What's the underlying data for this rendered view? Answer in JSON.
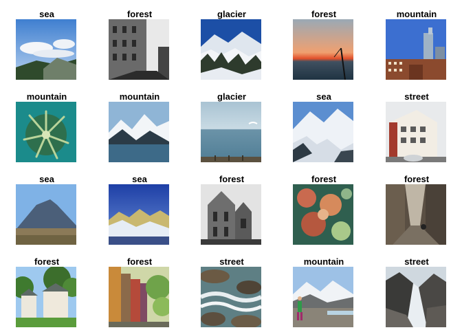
{
  "grid": {
    "rows": [
      [
        {
          "label": "sea",
          "scene": "sea-hills-clouds"
        },
        {
          "label": "forest",
          "scene": "bw-street-buildings"
        },
        {
          "label": "glacier",
          "scene": "snowy-mountain-trees"
        },
        {
          "label": "forest",
          "scene": "sunset-over-sea"
        },
        {
          "label": "mountain",
          "scene": "city-skyline"
        }
      ],
      [
        {
          "label": "mountain",
          "scene": "underwater-anemone"
        },
        {
          "label": "mountain",
          "scene": "snow-mountains-lake"
        },
        {
          "label": "glacier",
          "scene": "calm-sea-gull"
        },
        {
          "label": "sea",
          "scene": "snow-glacier-valley"
        },
        {
          "label": "street",
          "scene": "apartment-building"
        }
      ],
      [
        {
          "label": "sea",
          "scene": "volcano-peak"
        },
        {
          "label": "sea",
          "scene": "blue-mountain-range"
        },
        {
          "label": "forest",
          "scene": "bw-cathedral"
        },
        {
          "label": "forest",
          "scene": "coral-reef"
        },
        {
          "label": "forest",
          "scene": "narrow-alley"
        }
      ],
      [
        {
          "label": "forest",
          "scene": "round-pavilion-trees"
        },
        {
          "label": "forest",
          "scene": "colorful-street-buildings"
        },
        {
          "label": "street",
          "scene": "rocky-coast-waves"
        },
        {
          "label": "mountain",
          "scene": "hiker-mountain-valley"
        },
        {
          "label": "street",
          "scene": "rocky-gorge-snow"
        }
      ]
    ]
  }
}
